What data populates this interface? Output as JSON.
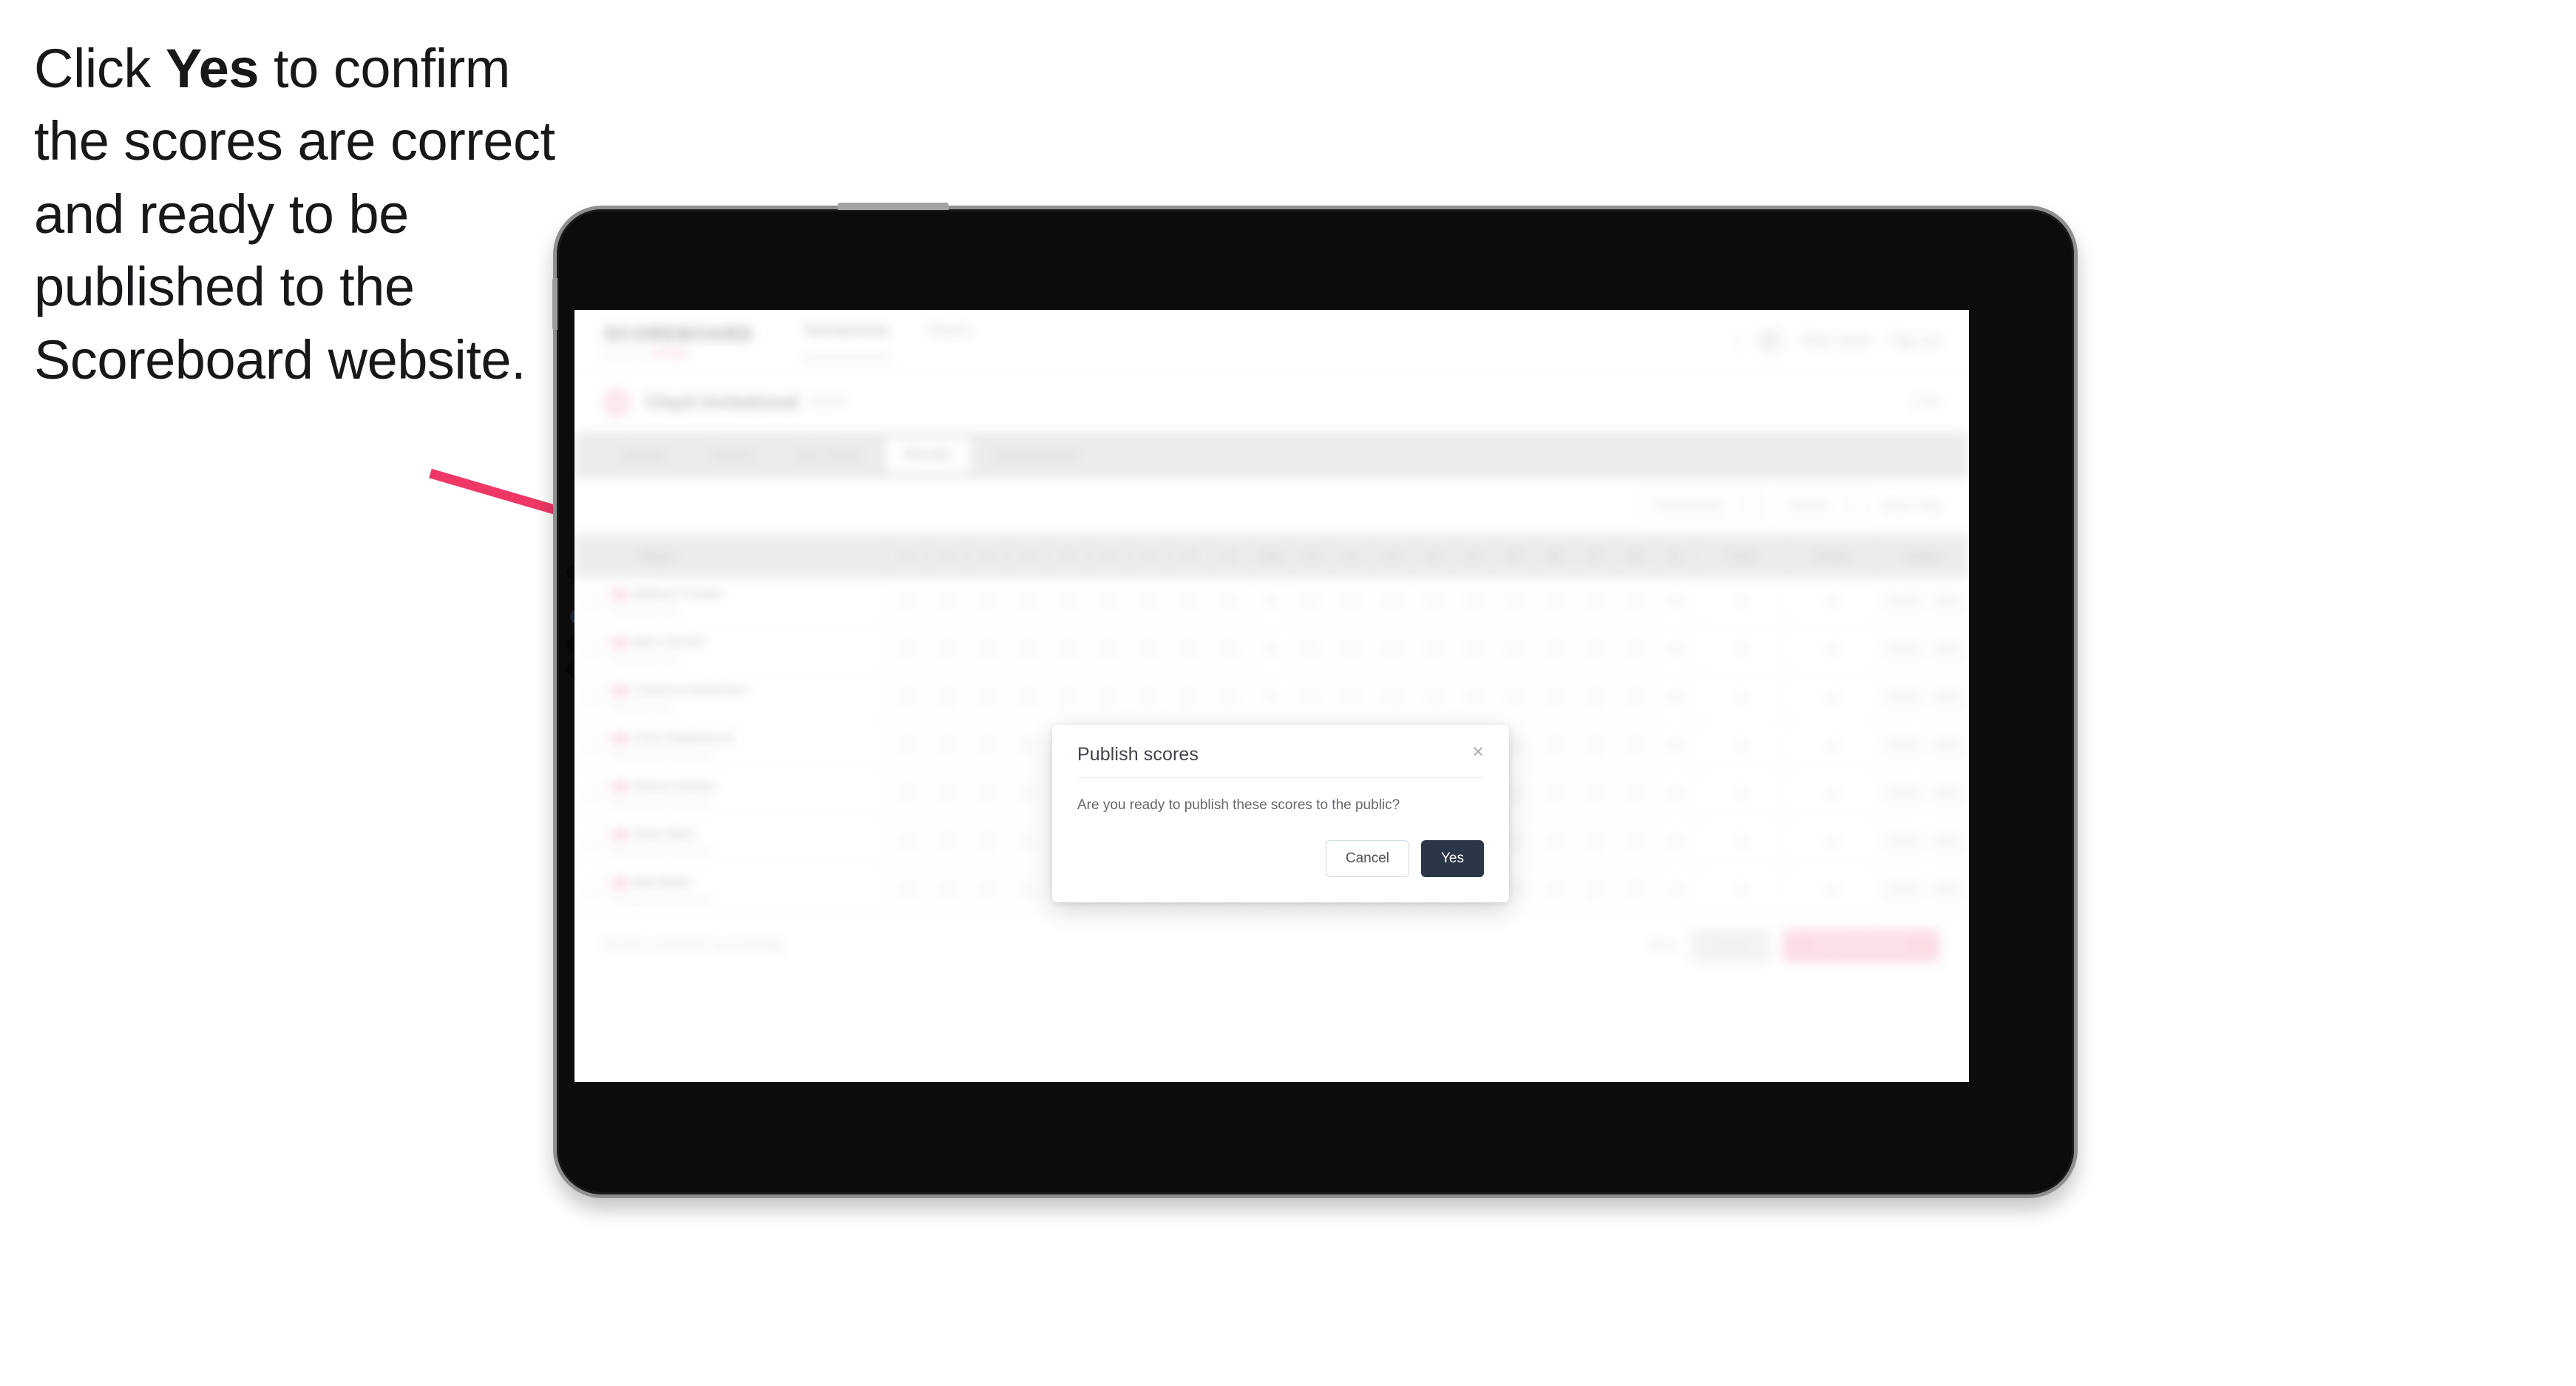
{
  "instruction": {
    "part1": "Click ",
    "emphasis": "Yes",
    "part2": " to confirm the scores are correct and ready to be published to the Scoreboard website."
  },
  "colors": {
    "arrow": "#ee3765",
    "accent_pink": "#ee3765",
    "primary_button": "#2b3648",
    "device_body": "#0c0c0c",
    "device_edge": "#8d8f91"
  },
  "app": {
    "brand": {
      "name": "SCOREBOARD",
      "sub_prefix": "powered by ",
      "sub_accent": "scoring"
    },
    "nav": [
      {
        "label": "Tournaments",
        "active": true
      },
      {
        "label": "Teams",
        "active": false
      }
    ],
    "header_right": {
      "avatar_icon": "user-icon",
      "user": "Mark Jones",
      "signout": "Sign out"
    },
    "page": {
      "badge_icon": "flag-icon",
      "title": "Clayd Invitational",
      "subtitle": "2024",
      "right_meta": "Live"
    },
    "tabs": [
      {
        "label": "Details",
        "active": false
      },
      {
        "label": "Teams",
        "active": false
      },
      {
        "label": "Tee Times",
        "active": false
      },
      {
        "label": "Results",
        "active": true
      },
      {
        "label": "Leaderboard",
        "active": false
      }
    ],
    "filters": {
      "round_select": "Final Round",
      "round_caret": "chevron-down-icon",
      "view_select": "Round",
      "view_caret": "chevron-down-icon",
      "right_text": "Team only"
    },
    "table": {
      "columns": [
        "Player",
        "1",
        "2",
        "3",
        "4",
        "5",
        "6",
        "7",
        "8",
        "9",
        "Out",
        "10",
        "11",
        "12",
        "13",
        "14",
        "15",
        "16",
        "17",
        "18",
        "In",
        "Total",
        "Points",
        "Status"
      ],
      "rows": [
        {
          "flag": "flag-icon",
          "name": "Mathew Tomato",
          "club": "Clayd Golf Club",
          "scores": [
            "4",
            "5",
            "3",
            "4",
            "4",
            "3",
            "5",
            "4",
            "4"
          ],
          "out": "36",
          "scores_in": [
            "4",
            "4",
            "3",
            "5",
            "4",
            "4",
            "3",
            "5",
            "4"
          ],
          "in": "36",
          "total": "72",
          "points": "10",
          "status": [
            "Verify",
            "Edit"
          ]
        },
        {
          "flag": "flag-icon",
          "name": "Marc Parnell",
          "club": "Clayd Golf Club",
          "scores": [
            "4",
            "4",
            "4",
            "3",
            "5",
            "4",
            "4",
            "3",
            "5"
          ],
          "out": "36",
          "scores_in": [
            "5",
            "3",
            "4",
            "4",
            "4",
            "5",
            "3",
            "4",
            "4"
          ],
          "in": "36",
          "total": "72",
          "points": "10",
          "status": [
            "Verify",
            "Edit"
          ]
        },
        {
          "flag": "flag-icon",
          "name": "Cameron Robertson",
          "club": "Parkview Golf",
          "scores": [
            "3",
            "5",
            "4",
            "4",
            "4",
            "4",
            "3",
            "5",
            "4"
          ],
          "out": "36",
          "scores_in": [
            "4",
            "4",
            "5",
            "3",
            "4",
            "4",
            "4",
            "3",
            "5"
          ],
          "in": "36",
          "total": "72",
          "points": "10",
          "status": [
            "Verify",
            "Edit"
          ]
        },
        {
          "flag": "flag-icon",
          "name": "Chris Stephenson",
          "club": "Bannerdown Links Golf",
          "scores": [
            "4",
            "4",
            "3",
            "5",
            "4",
            "4",
            "4",
            "3",
            "5"
          ],
          "out": "36",
          "scores_in": [
            "4",
            "5",
            "3",
            "4",
            "4",
            "4",
            "5",
            "3",
            "4"
          ],
          "in": "36",
          "total": "72",
          "points": "10",
          "status": [
            "Verify",
            "Edit"
          ]
        },
        {
          "flag": "flag-icon",
          "name": "Steven Gowen",
          "club": "Bannerdown Links Golf",
          "scores": [
            "5",
            "4",
            "4",
            "3",
            "4",
            "5",
            "4",
            "4",
            "3"
          ],
          "out": "36",
          "scores_in": [
            "4",
            "4",
            "4",
            "5",
            "3",
            "4",
            "4",
            "4",
            "4"
          ],
          "in": "36",
          "total": "72",
          "points": "10",
          "status": [
            "Verify",
            "Edit"
          ]
        },
        {
          "flag": "flag-icon",
          "name": "Steve Mott",
          "club": "Bannerdown Links Golf",
          "scores": [
            "4",
            "3",
            "5",
            "4",
            "4",
            "4",
            "3",
            "5",
            "4"
          ],
          "out": "36",
          "scores_in": [
            "4",
            "4",
            "4",
            "3",
            "5",
            "4",
            "4",
            "4",
            "4"
          ],
          "in": "36",
          "total": "72",
          "points": "10",
          "status": [
            "Verify",
            "Edit"
          ]
        },
        {
          "flag": "flag-icon",
          "name": "Bob Baker",
          "club": "Bannerdown Links Golf",
          "scores": [
            "4",
            "4",
            "4",
            "4",
            "3",
            "5",
            "4",
            "4",
            "4"
          ],
          "out": "36",
          "scores_in": [
            "3",
            "5",
            "4",
            "4",
            "4",
            "4",
            "4",
            "3",
            "5"
          ],
          "in": "36",
          "total": "72",
          "points": "10",
          "status": [
            "Verify",
            "Edit"
          ]
        }
      ]
    },
    "footer": {
      "note": "Scores unverified successfully",
      "link": "Back",
      "secondary_button": "Save",
      "danger_button": "Publish all scores"
    }
  },
  "modal": {
    "title": "Publish scores",
    "close_icon": "close-icon",
    "body": "Are you ready to publish these scores to the public?",
    "cancel_label": "Cancel",
    "yes_label": "Yes"
  }
}
